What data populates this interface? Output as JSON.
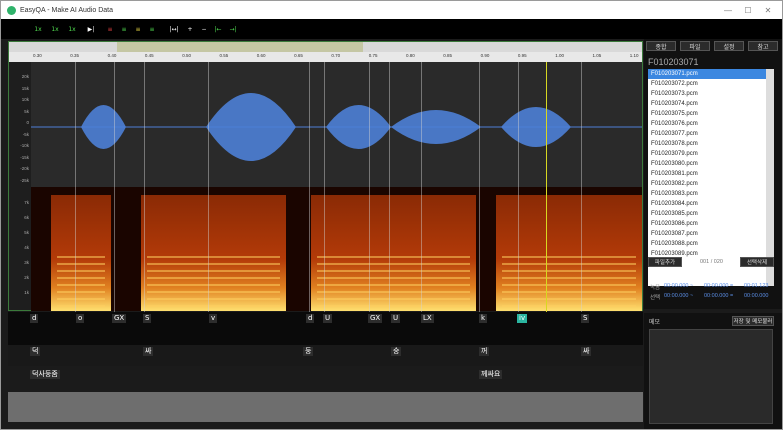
{
  "window": {
    "title": "EasyQA - Make AI Audio Data",
    "controls": [
      "—",
      "☐",
      "✕"
    ]
  },
  "toolbar": {
    "buttons": [
      {
        "name": "play-slow",
        "label": "1x"
      },
      {
        "name": "play-mid",
        "label": "1x"
      },
      {
        "name": "play-fast",
        "label": "1x"
      },
      {
        "name": "next",
        "label": "▶|"
      },
      {
        "name": "align-1",
        "label": "≡"
      },
      {
        "name": "align-2",
        "label": "≡"
      },
      {
        "name": "align-3",
        "label": "≡"
      },
      {
        "name": "align-4",
        "label": "≡"
      },
      {
        "name": "fit",
        "label": "|↔|"
      },
      {
        "name": "zoom-in",
        "label": "+"
      },
      {
        "name": "zoom-out",
        "label": "−"
      },
      {
        "name": "mark-start",
        "label": "|←"
      },
      {
        "name": "mark-end",
        "label": "→|"
      }
    ]
  },
  "ruler": {
    "ticks": [
      "0.30",
      "0.35",
      "0.40",
      "0.45",
      "0.50",
      "0.55",
      "0.60",
      "0.65",
      "0.70",
      "0.75",
      "0.80",
      "0.85",
      "0.90",
      "0.95",
      "1.00",
      "1.05",
      "1.10"
    ]
  },
  "waveform": {
    "y_labels": [
      "20k",
      "15k",
      "10k",
      "5k",
      "0",
      "-5k",
      "-10k",
      "-15k",
      "-20k",
      "-25k"
    ]
  },
  "spectrogram": {
    "y_labels": [
      "7k",
      "6k",
      "5k",
      "4k",
      "3k",
      "2k",
      "1k"
    ]
  },
  "tiers": {
    "phones": [
      "d",
      "o",
      "GX",
      "S",
      "v",
      "d",
      "U",
      "GX",
      "U",
      "LX",
      "k",
      "iv",
      "S"
    ],
    "syllables": [
      "덕",
      "싸",
      "둥",
      "숭",
      "꺼",
      "싸"
    ],
    "words": [
      "덕사둥줌",
      "께싸요"
    ]
  },
  "side": {
    "buttons": [
      "종합",
      "파일",
      "설정",
      "참고"
    ],
    "current_file": "F010203071",
    "files": [
      "F010203071.pcm",
      "F010203072.pcm",
      "F010203073.pcm",
      "F010203074.pcm",
      "F010203075.pcm",
      "F010203076.pcm",
      "F010203077.pcm",
      "F010203078.pcm",
      "F010203079.pcm",
      "F010203080.pcm",
      "F010203081.pcm",
      "F010203082.pcm",
      "F010203083.pcm",
      "F010203084.pcm",
      "F010203085.pcm",
      "F010203086.pcm",
      "F010203087.pcm",
      "F010203088.pcm",
      "F010203089.pcm"
    ],
    "add_file": "파일추가",
    "count": "001 / 020",
    "delete": "선택삭제",
    "time_labels": [
      "녹음",
      "선택"
    ],
    "time_rows": [
      [
        "00:00.000",
        "~",
        "00:00.000",
        "=",
        "00:01.123"
      ],
      [
        "00:00.000",
        "~",
        "00:00.000",
        "=",
        "00:00.000"
      ]
    ]
  },
  "memo": {
    "label": "메모",
    "save": "저장 및 메모불러"
  }
}
